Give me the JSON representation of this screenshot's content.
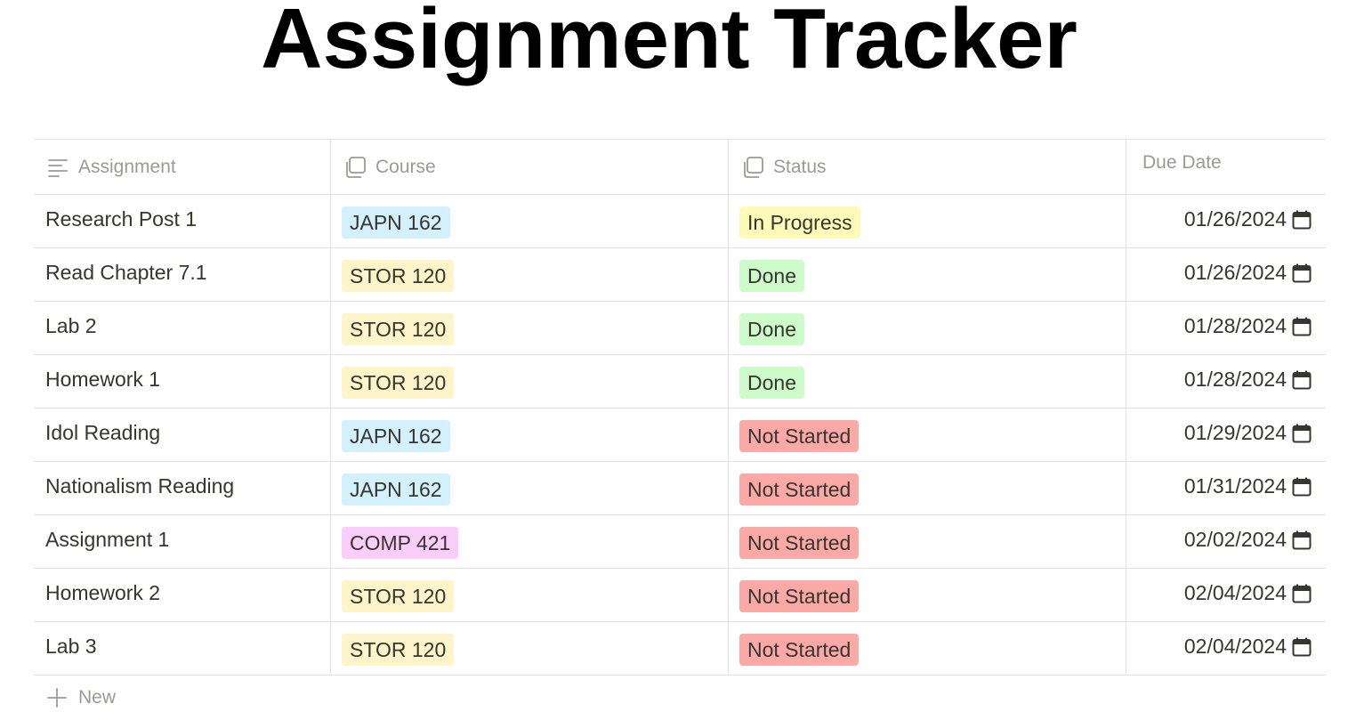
{
  "page": {
    "title": "Assignment Tracker"
  },
  "table": {
    "columns": [
      {
        "label": "Assignment",
        "icon": "text-lines-icon"
      },
      {
        "label": "Course",
        "icon": "multi-select-icon"
      },
      {
        "label": "Status",
        "icon": "multi-select-icon"
      },
      {
        "label": "Due Date",
        "icon": ""
      }
    ],
    "rows": [
      {
        "assignment": "Research Post 1",
        "course": "JAPN 162",
        "status": "In Progress",
        "due": "01/26/2024"
      },
      {
        "assignment": "Read Chapter 7.1",
        "course": "STOR 120",
        "status": "Done",
        "due": "01/26/2024"
      },
      {
        "assignment": "Lab 2",
        "course": "STOR 120",
        "status": "Done",
        "due": "01/28/2024"
      },
      {
        "assignment": "Homework 1",
        "course": "STOR 120",
        "status": "Done",
        "due": "01/28/2024"
      },
      {
        "assignment": "Idol Reading",
        "course": "JAPN 162",
        "status": "Not Started",
        "due": "01/29/2024"
      },
      {
        "assignment": "Nationalism Reading",
        "course": "JAPN 162",
        "status": "Not Started",
        "due": "01/31/2024"
      },
      {
        "assignment": "Assignment 1",
        "course": "COMP 421",
        "status": "Not Started",
        "due": "02/02/2024"
      },
      {
        "assignment": "Homework 2",
        "course": "STOR 120",
        "status": "Not Started",
        "due": "02/04/2024"
      },
      {
        "assignment": "Lab 3",
        "course": "STOR 120",
        "status": "Not Started",
        "due": "02/04/2024"
      }
    ],
    "new_label": "New"
  },
  "colors": {
    "course": {
      "JAPN 162": "#d3f1fb",
      "STOR 120": "#fdf5c9",
      "COMP 421": "#fbcdfb"
    },
    "status": {
      "In Progress": "#fdfbb7",
      "Done": "#cdfbc9",
      "Not Started": "#fba9a6"
    }
  }
}
